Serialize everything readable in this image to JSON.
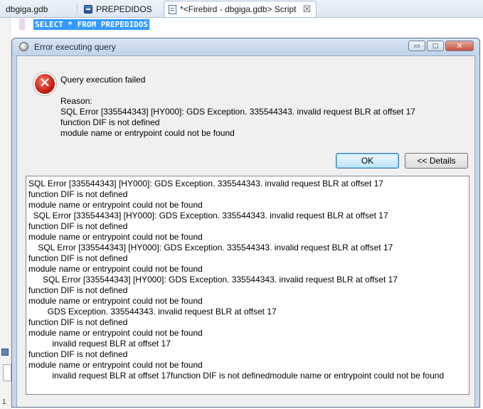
{
  "tabs": [
    {
      "label": "dbgiga.gdb",
      "icon": "database-icon"
    },
    {
      "label": "PREPEDIDOS",
      "icon": "table-icon"
    },
    {
      "label": "*<Firebird - dbgiga.gdb> Script",
      "icon": "script-icon",
      "close": "☒"
    }
  ],
  "editor": {
    "sql": "SELECT * FROM PREPEDIDOS",
    "line_number": "1"
  },
  "dialog": {
    "title": "Error executing query",
    "window_buttons": {
      "minimize": "▭",
      "maximize": "▢",
      "close": "✕"
    },
    "heading": "Query execution failed",
    "reason_label": "Reason:",
    "reason_lines": [
      "SQL Error [335544343] [HY000]: GDS Exception. 335544343. invalid request BLR at offset 17",
      "function DIF is not defined",
      "module name or entrypoint could not be found"
    ],
    "ok_label": "OK",
    "details_label": "<< Details",
    "details_lines": [
      "SQL Error [335544343] [HY000]: GDS Exception. 335544343. invalid request BLR at offset 17",
      "function DIF is not defined",
      "module name or entrypoint could not be found",
      "  SQL Error [335544343] [HY000]: GDS Exception. 335544343. invalid request BLR at offset 17",
      "function DIF is not defined",
      "module name or entrypoint could not be found",
      "    SQL Error [335544343] [HY000]: GDS Exception. 335544343. invalid request BLR at offset 17",
      "function DIF is not defined",
      "module name or entrypoint could not be found",
      "      SQL Error [335544343] [HY000]: GDS Exception. 335544343. invalid request BLR at offset 17",
      "function DIF is not defined",
      "module name or entrypoint could not be found",
      "        GDS Exception. 335544343. invalid request BLR at offset 17",
      "function DIF is not defined",
      "module name or entrypoint could not be found",
      "          invalid request BLR at offset 17",
      "function DIF is not defined",
      "module name or entrypoint could not be found",
      "          invalid request BLR at offset 17function DIF is not definedmodule name or entrypoint could not be found"
    ]
  },
  "colors": {
    "selection": "#3399ff",
    "error_red": "#c5200e",
    "dialog_frame": "#c6d7ec"
  }
}
